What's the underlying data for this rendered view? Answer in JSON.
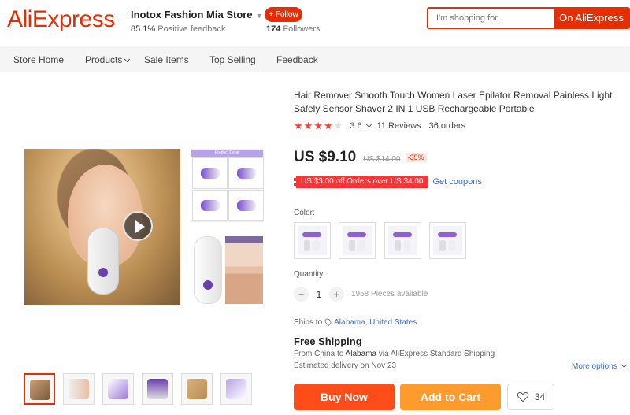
{
  "header": {
    "logo": "AliExpress",
    "store_name": "Inotox Fashion Mia Store",
    "feedback_value": "85.1%",
    "feedback_label": "Positive feedback",
    "follow_label": "+ Follow",
    "followers_count": "174",
    "followers_label": "Followers",
    "search_placeholder": "I'm shopping for...",
    "search_button": "On AliExpress"
  },
  "nav": {
    "items": [
      {
        "label": "Store Home"
      },
      {
        "label": "Products"
      },
      {
        "label": "Sale Items"
      },
      {
        "label": "Top Selling"
      },
      {
        "label": "Feedback"
      }
    ]
  },
  "product": {
    "title": "Hair Remover Smooth Touch Women Laser Epilator Removal Painless Light Safely Sensor Shaver 2 IN 1 USB Rechargeable Portable",
    "rating": "3.6",
    "stars_filled": 4,
    "reviews": "11 Reviews",
    "orders": "36 orders",
    "price": "US $9.10",
    "original_price": "US $14.00",
    "discount": "-35%",
    "coupon": "US $3.00 off Orders over US $4.00",
    "get_coupons": "Get coupons",
    "color_label": "Color:",
    "quantity_label": "Quantity:",
    "quantity_minus": "−",
    "quantity_value": "1",
    "quantity_plus": "+",
    "quantity_available": "1958 Pieces available",
    "ships_to_label": "Ships to",
    "ships_to_location": "Alabama, United States",
    "free_shipping": "Free Shipping",
    "shipping_from_prefix": "From China to",
    "shipping_from_dest": "Alabama",
    "shipping_via": "via AliExpress Standard Shipping",
    "delivery": "Estimated delivery on Nov 23",
    "more_options": "More options",
    "buy_now": "Buy Now",
    "add_to_cart": "Add to Cart",
    "wishlist_count": "34",
    "side_image_banner": "Product Detail"
  },
  "colors": {
    "brand": "#e62e04",
    "buy_now": "#ff4d1a",
    "add_to_cart": "#ff9a2c",
    "link": "#3a6cc7",
    "star": "#f44336"
  }
}
